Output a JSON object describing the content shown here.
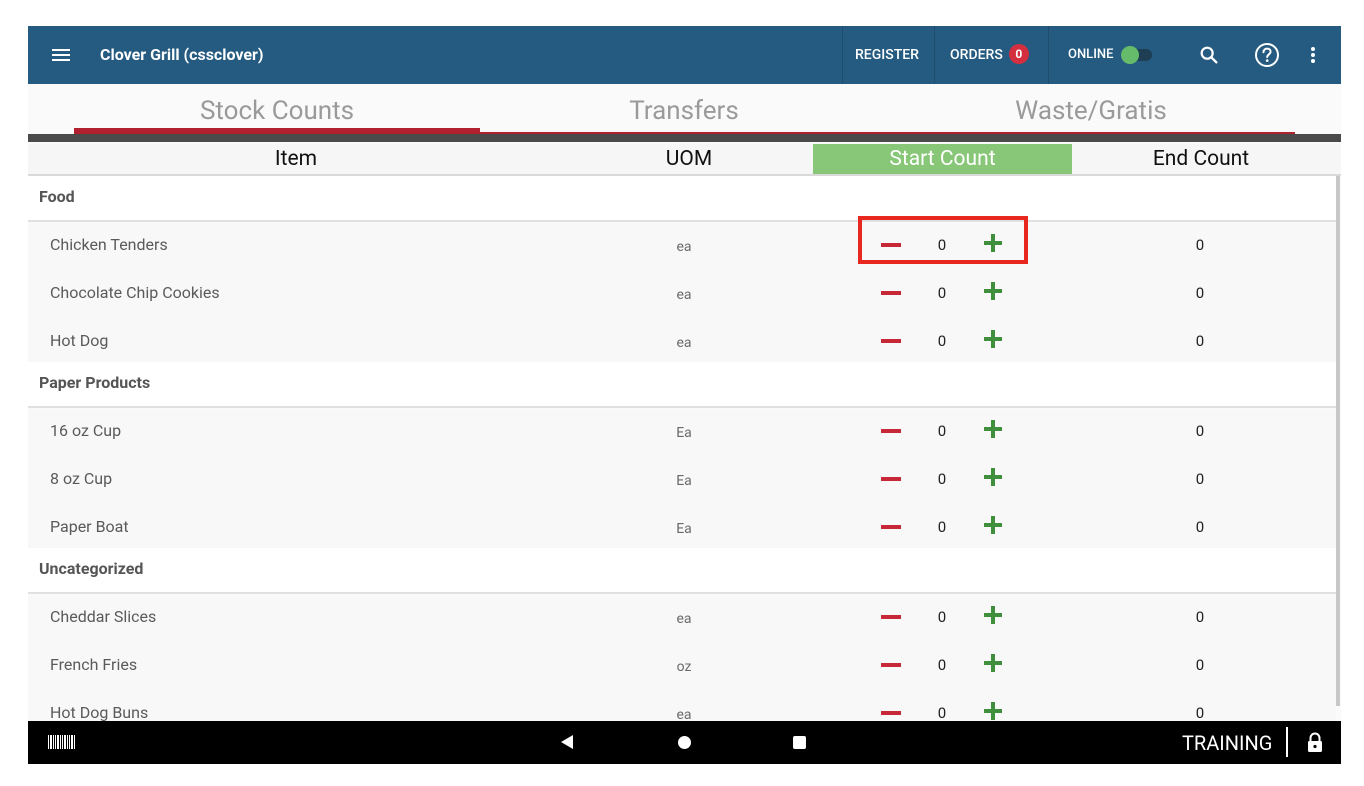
{
  "header": {
    "title": "Clover Grill (cssclover)",
    "register_label": "REGISTER",
    "orders_label": "ORDERS",
    "orders_count": "0",
    "online_label": "ONLINE",
    "online_toggle_on": true
  },
  "tabs": [
    {
      "label": "Stock Counts",
      "active": true
    },
    {
      "label": "Transfers",
      "active": false
    },
    {
      "label": "Waste/Gratis",
      "active": false
    }
  ],
  "columns": {
    "item": "Item",
    "uom": "UOM",
    "start": "Start Count",
    "end": "End Count"
  },
  "sections": [
    {
      "name": "Food",
      "items": [
        {
          "name": "Chicken Tenders",
          "uom": "ea",
          "start": "0",
          "end": "0"
        },
        {
          "name": "Chocolate Chip Cookies",
          "uom": "ea",
          "start": "0",
          "end": "0"
        },
        {
          "name": "Hot Dog",
          "uom": "ea",
          "start": "0",
          "end": "0"
        }
      ]
    },
    {
      "name": "Paper Products",
      "items": [
        {
          "name": "16 oz Cup",
          "uom": "Ea",
          "start": "0",
          "end": "0"
        },
        {
          "name": "8 oz Cup",
          "uom": "Ea",
          "start": "0",
          "end": "0"
        },
        {
          "name": "Paper Boat",
          "uom": "Ea",
          "start": "0",
          "end": "0"
        }
      ]
    },
    {
      "name": "Uncategorized",
      "items": [
        {
          "name": "Cheddar Slices",
          "uom": "ea",
          "start": "0",
          "end": "0"
        },
        {
          "name": "French Fries",
          "uom": "oz",
          "start": "0",
          "end": "0"
        },
        {
          "name": "Hot Dog Buns",
          "uom": "ea",
          "start": "0",
          "end": "0"
        }
      ]
    }
  ],
  "navbar": {
    "mode_label": "TRAINING"
  },
  "colors": {
    "header_bg": "#255b80",
    "accent_red": "#b0202e",
    "start_count_bg": "#88c778",
    "minus": "#c62838",
    "plus": "#3f8f3c",
    "highlight_box": "#e8281e"
  },
  "icons": [
    "menu-icon",
    "search-icon",
    "help-icon",
    "more-vert-icon",
    "barcode-icon",
    "back-icon",
    "home-icon",
    "recents-icon",
    "lock-icon",
    "minus-icon",
    "plus-icon"
  ]
}
